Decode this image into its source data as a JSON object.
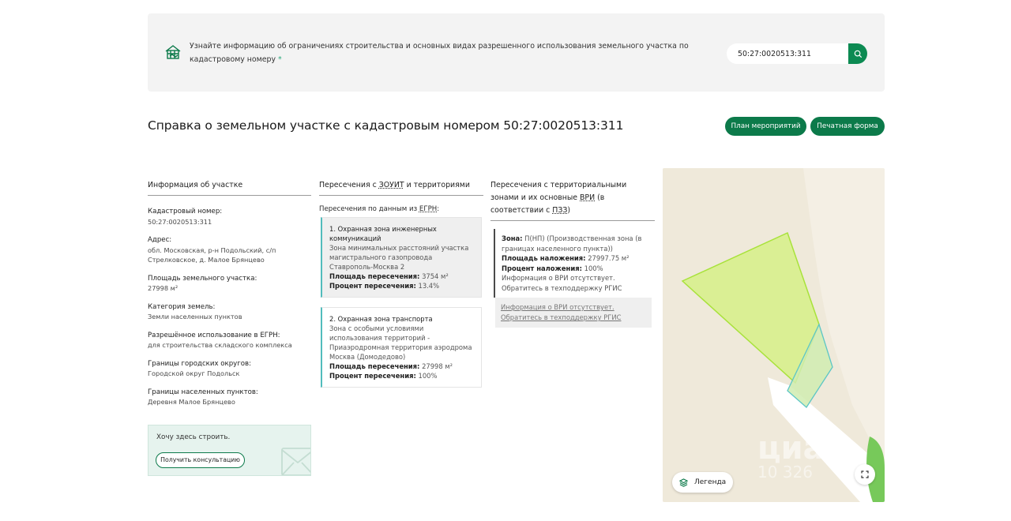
{
  "banner": {
    "text": "Узнайте информацию об ограничениях строительства и основных видах разрешенного использования земельного участка по кадастровому номеру",
    "asterisk": "*",
    "search_value": "50:27:0020513:311"
  },
  "header": {
    "title": "Справка о земельном участке с кадастровым номером 50:27:0020513:311",
    "btn_plan": "План мероприятий",
    "btn_print": "Печатная форма"
  },
  "col1": {
    "heading": "Информация об участке",
    "items": [
      {
        "label": "Кадастровый номер:",
        "value": "50:27:0020513:311"
      },
      {
        "label": "Адрес:",
        "value": "обл. Московская, р-н Подольский, с/п Стрелковское, д. Малое Брянцево"
      },
      {
        "label": "Площадь земельного участка:",
        "value": "27998 м²"
      },
      {
        "label": "Категория земель:",
        "value": "Земли населенных пунктов"
      },
      {
        "label": "Разрешённое использование в ЕГРН:",
        "value": "для строительства складского комплекса"
      },
      {
        "label": "Границы городских округов:",
        "value": "Городской округ Подольск"
      },
      {
        "label": "Границы населенных пунктов:",
        "value": "Деревня Малое Брянцево"
      }
    ],
    "consult_text": "Хочу здесь строить.",
    "consult_btn": "Получить консультацию"
  },
  "col2": {
    "heading_pre": "Пересечения с ",
    "heading_abbr": "ЗОУИТ",
    "heading_post": " и территориями",
    "sub_pre": "Пересечения по данным из ",
    "sub_abbr": "ЕГРН",
    "sub_post": ":",
    "cards": [
      {
        "title": "1. Охранная зона инженерных коммуникаций",
        "desc": "Зона минимальных расстояний участка магистрального газопровода Ставрополь-Москва 2",
        "area_label": "Площадь пересечения:",
        "area_value": "3754 м²",
        "pct_label": "Процент пересечения:",
        "pct_value": "13.4%"
      },
      {
        "title": "2. Охранная зона транспорта",
        "desc": "Зона с особыми условиями использования территорий - Приаэродромная территория аэродрома Москва (Домодедово)",
        "area_label": "Площадь пересечения:",
        "area_value": "27998 м²",
        "pct_label": "Процент пересечения:",
        "pct_value": "100%"
      }
    ]
  },
  "col3": {
    "heading_pre": "Пересечения с территориальными зонами и их основные ",
    "heading_abbr1": "ВРИ",
    "heading_mid": " (в соответствии с ",
    "heading_abbr2": "ПЗЗ",
    "heading_post": ")",
    "zone_label": "Зона:",
    "zone_value": "П(НП) (Производственная зона (в границах населенного пункта))",
    "area_label": "Площадь наложения:",
    "area_value": "27997.75 м²",
    "pct_label": "Процент наложения:",
    "pct_value": "100%",
    "vri_text": "Информация о ВРИ отсутствует. Обратитесь в техподдержку РГИС",
    "note": "Информация о ВРИ отсутствует. Обратитесь в техподдержку РГИС"
  },
  "map": {
    "legend_label": "Легенда",
    "watermark_brand": "циан",
    "watermark_num": "10 326"
  },
  "colors": {
    "accent": "#0c7a4a",
    "parcel_fill": "#d7ef8c",
    "parcel_stroke": "#a8e23a",
    "zone_stroke": "#5cc6c6"
  }
}
